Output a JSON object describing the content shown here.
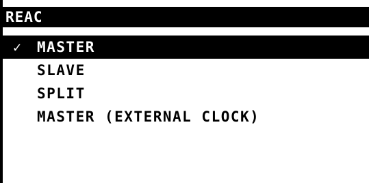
{
  "title": "REAC",
  "menu": {
    "items": [
      {
        "label": "MASTER",
        "checked": true,
        "selected": true
      },
      {
        "label": "SLAVE",
        "checked": false,
        "selected": false
      },
      {
        "label": "SPLIT",
        "checked": false,
        "selected": false
      },
      {
        "label": "MASTER (EXTERNAL CLOCK)",
        "checked": false,
        "selected": false
      }
    ]
  },
  "icons": {
    "check_mark": "checkmark-icon"
  },
  "colors": {
    "background": "#ffffff",
    "foreground": "#000000",
    "highlight": "#000000",
    "highlight_text": "#ffffff"
  }
}
